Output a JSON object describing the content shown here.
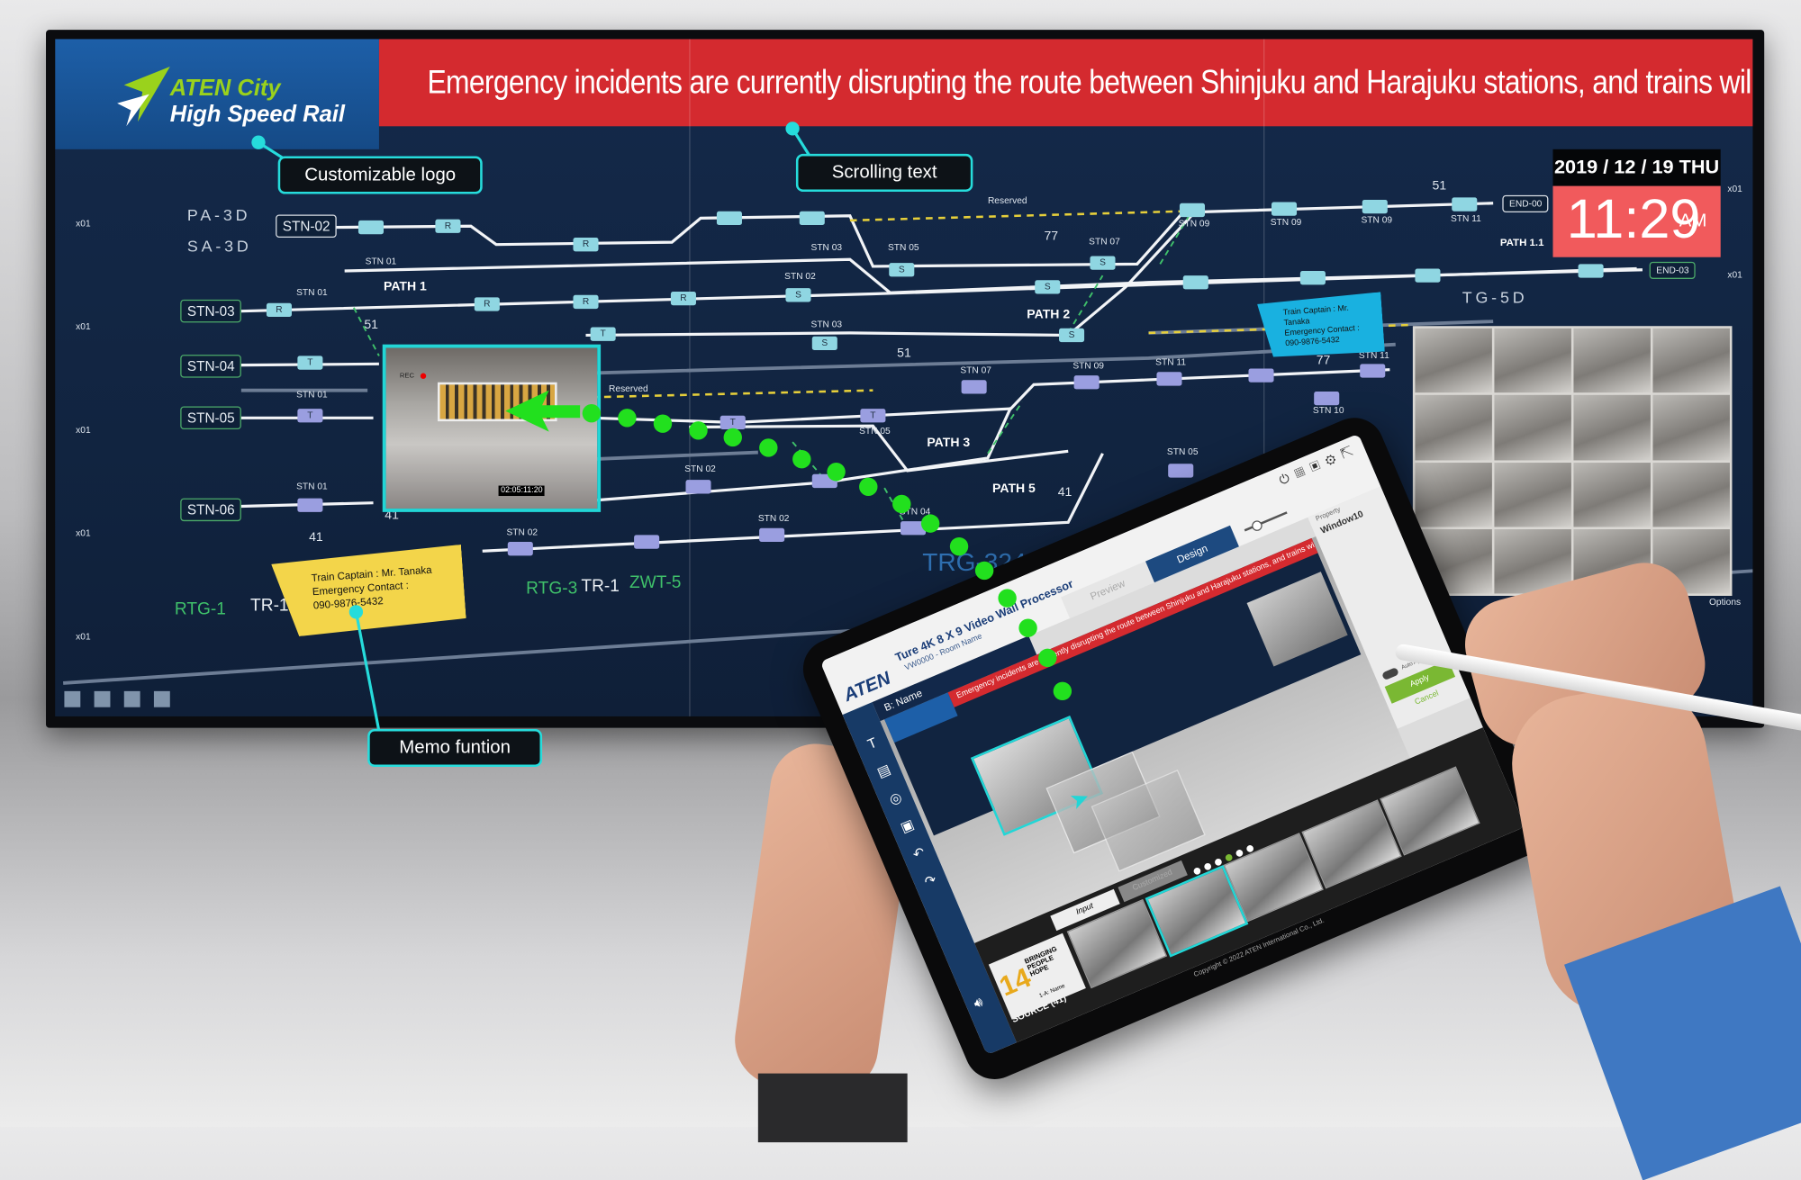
{
  "wall": {
    "logo": {
      "line1": "ATEN City",
      "line2": "High Speed Rail"
    },
    "scrolling_text": "Emergency incidents are currently disrupting the route between Shinjuku and Harajuku stations, and trains will be delayed.",
    "clock": {
      "date": "2019 / 12 / 19  THU",
      "time": "11:29",
      "ampm": "AM"
    },
    "tags": {
      "pa": "PA-3D",
      "sa": "SA-3D",
      "tg": "TG-5D"
    },
    "stations": [
      "STN-02",
      "STN-03",
      "STN-04",
      "STN-05",
      "STN-06"
    ],
    "ends": [
      "END-00",
      "END-03"
    ],
    "paths": [
      "PATH 1",
      "PATH 2",
      "PATH 3",
      "PATH 5",
      "PATH 1.1"
    ],
    "reserved": "Reserved",
    "small_labels": [
      "STN 01",
      "STN 01",
      "STN 01",
      "STN 01",
      "STN 02",
      "STN 03",
      "STN 03",
      "STN 05",
      "STN 07",
      "STN 09",
      "STN 09",
      "STN 09",
      "STN 11",
      "STN 07",
      "STN 09",
      "STN 11",
      "STN 11",
      "STN 10",
      "STN 05",
      "STN 02",
      "STN 02",
      "STN 02",
      "STN 04",
      "STN 05"
    ],
    "numbers": [
      "51",
      "77",
      "51",
      "51",
      "77",
      "41",
      "41",
      "41"
    ],
    "route_codes": {
      "rtg1": "RTG-1",
      "tr1a": "TR-1",
      "rtg3": "RTG-3",
      "tr1b": "TR-1",
      "zwt5": "ZWT-5",
      "trg": "TRG-324"
    },
    "side_marks": [
      "x01",
      "x01",
      "x01",
      "x01",
      "x01",
      "x01",
      "x01"
    ],
    "track_markers": [
      "",
      "R",
      "R",
      "",
      "",
      "S",
      "S",
      "",
      "",
      "",
      "",
      "R",
      "R",
      "R",
      "R",
      "S",
      "S",
      "",
      "",
      "",
      "",
      "T",
      "S",
      "S",
      "T",
      "T",
      "T",
      "T",
      "",
      "",
      "",
      "",
      "",
      "",
      "",
      "",
      "",
      "",
      "",
      "",
      "",
      ""
    ],
    "camera_timestamp": "02:05:11:20",
    "camera_rec": "REC",
    "memo_yellow": [
      "Train Captain : Mr. Tanaka",
      "Emergency Contact :",
      "090-9876-5432"
    ],
    "memo_blue": [
      "Train Captain : Mr. Tanaka",
      "Emergency Contact :",
      "090-9876-5432"
    ],
    "options": "Options"
  },
  "callouts": {
    "logo": "Customizable logo",
    "scroll": "Scrolling text",
    "memo": "Memo funtion"
  },
  "tablet": {
    "brand": "ATEN",
    "title": "Ture 4K 8 X 9 Video Wall Processor",
    "subtitle": "VW0000 - Room Name",
    "tabs": [
      "Preview",
      "Design"
    ],
    "active_tab": "Design",
    "name_label": "B: Name",
    "property_label": "Property",
    "property_value": "Window10",
    "auto_apply": "Auto Apply",
    "apply": "Apply",
    "cancel": "Cancel",
    "source_label": "SOURCE (41)",
    "source_tabs": [
      "Input",
      "Customized"
    ],
    "source_item": {
      "title": "BRINGING PEOPLE HOPE",
      "number": "14",
      "name": "1-A: Name"
    },
    "pagination": {
      "pages": 6,
      "current": 4
    },
    "copyright": "Copyright © 2022 ATEN International Co., Ltd.",
    "mini_banner": "Emergency incidents are currently disrupting the route between Shinjuku and Harajuku stations, and trains will be delayed."
  },
  "colors": {
    "banner": "#d42a2f",
    "clock": "#f15a5c",
    "callout": "#26dcdc",
    "path_dots": "#22e01e",
    "apply": "#7ab833"
  }
}
